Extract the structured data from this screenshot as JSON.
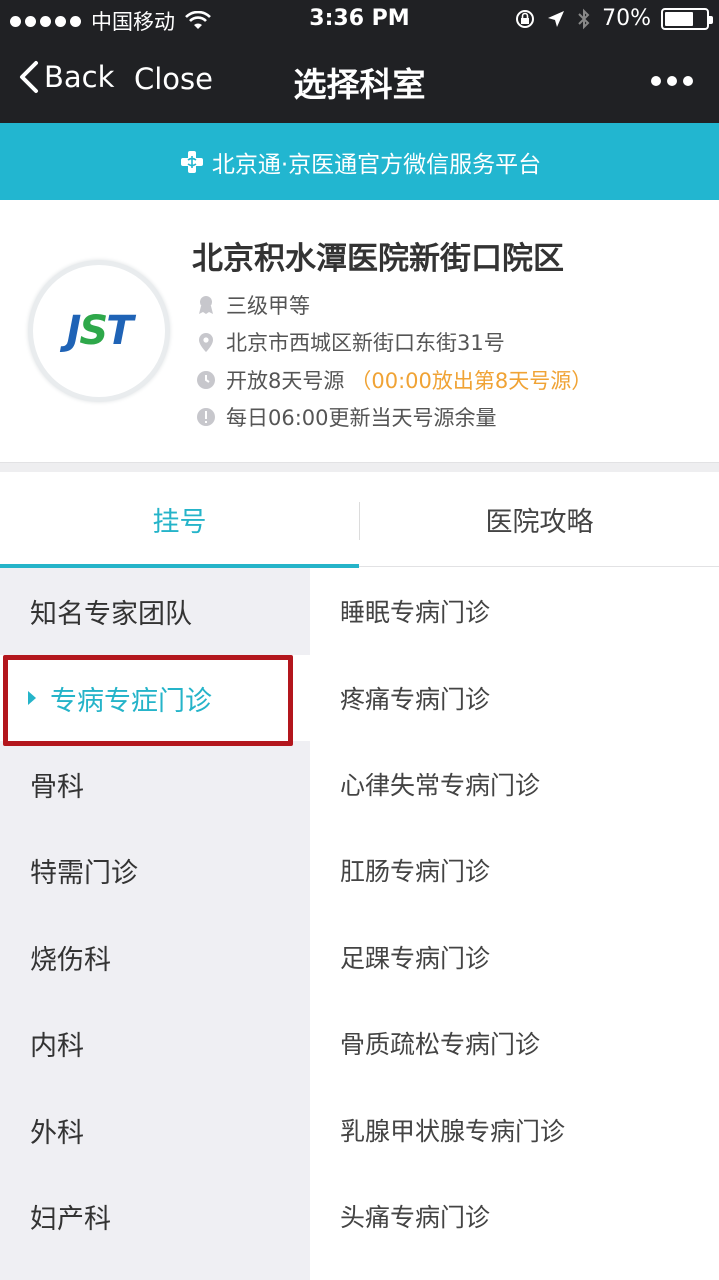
{
  "status_bar": {
    "carrier": "中国移动",
    "time": "3:36 PM",
    "battery": "70%",
    "battery_level": 0.7
  },
  "nav": {
    "back_label": "Back",
    "close_label": "Close",
    "title": "选择科室"
  },
  "banner": {
    "text": "北京通·京医通官方微信服务平台"
  },
  "hospital": {
    "name": "北京积水潭医院新街口院区",
    "logo_text_a": "J",
    "logo_text_b": "S",
    "logo_text_c": "T",
    "level": "三级甲等",
    "address": "北京市西城区新街口东街31号",
    "open_days": "开放8天号源",
    "open_days_note": "（00:00放出第8天号源）",
    "update_info": "每日06:00更新当天号源余量"
  },
  "tabs": [
    {
      "label": "挂号",
      "active": true
    },
    {
      "label": "医院攻略",
      "active": false
    }
  ],
  "categories": [
    {
      "label": "知名专家团队"
    },
    {
      "label": "专病专症门诊",
      "selected": true
    },
    {
      "label": "骨科"
    },
    {
      "label": "特需门诊"
    },
    {
      "label": "烧伤科"
    },
    {
      "label": "内科"
    },
    {
      "label": "外科"
    },
    {
      "label": "妇产科"
    }
  ],
  "departments": [
    {
      "label": "睡眠专病门诊"
    },
    {
      "label": "疼痛专病门诊"
    },
    {
      "label": "心律失常专病门诊"
    },
    {
      "label": "肛肠专病门诊"
    },
    {
      "label": "足踝专病门诊"
    },
    {
      "label": "骨质疏松专病门诊"
    },
    {
      "label": "乳腺甲状腺专病门诊"
    },
    {
      "label": "头痛专病门诊"
    }
  ],
  "colors": {
    "accent": "#25b4c9",
    "banner": "#22b6d0",
    "highlight_border": "#b3161d",
    "orange_note": "#f0a335"
  }
}
